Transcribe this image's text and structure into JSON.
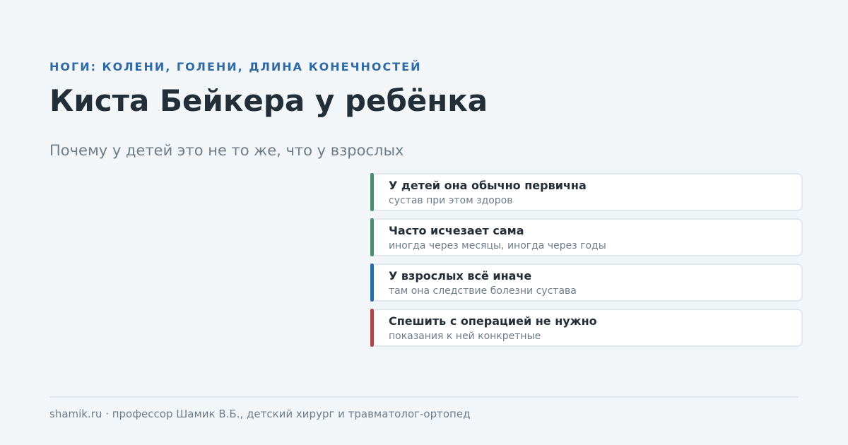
{
  "header": {
    "kicker": "НОГИ: КОЛЕНИ, ГОЛЕНИ, ДЛИНА КОНЕЧНОСТЕЙ",
    "title": "Киста Бейкера у ребёнка",
    "subtitle": "Почему у детей это не то же, что у взрослых"
  },
  "cards": [
    {
      "title": "У детей она обычно первична",
      "subtitle": "сустав при этом здоров",
      "accent": "#4e8a6c"
    },
    {
      "title": "Часто исчезает сама",
      "subtitle": "иногда через месяцы, иногда через годы",
      "accent": "#4e8a6c"
    },
    {
      "title": "У взрослых всё иначе",
      "subtitle": "там она следствие болезни сустава",
      "accent": "#2e6aa3"
    },
    {
      "title": "Спешить с операцией не нужно",
      "subtitle": "показания к ней конкретные",
      "accent": "#b04545"
    }
  ],
  "footer": {
    "text": "shamik.ru · профессор Шамик В.Б., детский хирург и травматолог-ортопед"
  }
}
